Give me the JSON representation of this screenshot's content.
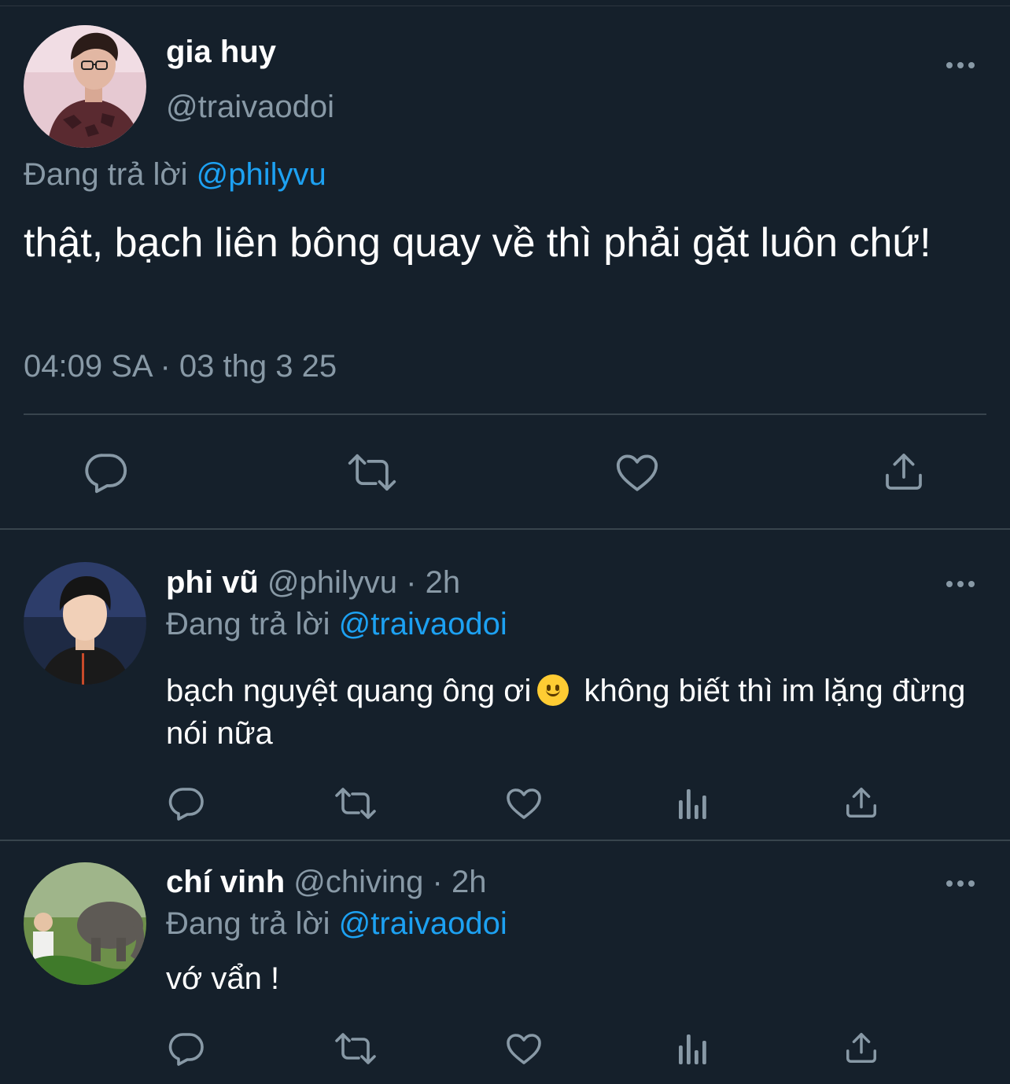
{
  "main_tweet": {
    "name": "gia huy",
    "handle": "@traivaodoi",
    "reply_prefix": "Đang trả lời",
    "reply_to": "@philyvu",
    "text": "thật, bạch liên bông quay về thì phải gặt luôn chứ!",
    "timestamp": "04:09 SA · 03 thg 3 25",
    "actions": [
      "reply-icon",
      "retweet-icon",
      "like-icon",
      "share-icon"
    ]
  },
  "replies": [
    {
      "name": "phi vũ",
      "handle": "@philyvu",
      "time": "· 2h",
      "reply_prefix": "Đang trả lời",
      "reply_to": "@traivaodoi",
      "text_before_emoji": "bạch nguyệt quang ông ơi",
      "emoji": "slightly-smiling-face",
      "text_after_emoji": "không biết thì im lặng đừng nói nữa",
      "actions": [
        "reply-icon",
        "retweet-icon",
        "like-icon",
        "analytics-icon",
        "share-icon"
      ]
    },
    {
      "name": "chí vinh",
      "handle": "@chiving",
      "time": "· 2h",
      "reply_prefix": "Đang trả lời",
      "reply_to": "@traivaodoi",
      "text": "vớ vẩn !",
      "actions": [
        "reply-icon",
        "retweet-icon",
        "like-icon",
        "analytics-icon",
        "share-icon"
      ]
    }
  ],
  "colors": {
    "background": "#15202b",
    "text_primary": "#ffffff",
    "text_secondary": "#8899a6",
    "accent": "#1da1f2",
    "divider": "#38444d"
  }
}
